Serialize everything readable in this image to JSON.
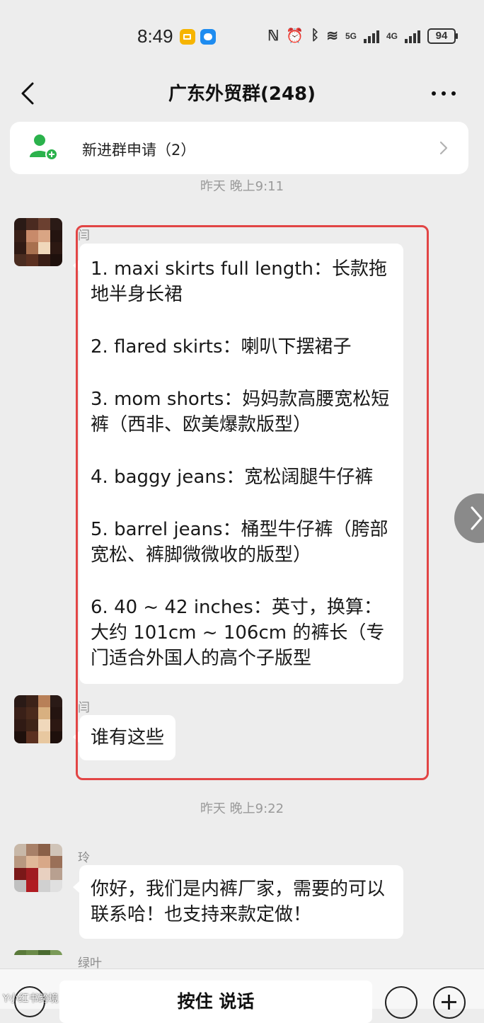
{
  "status_bar": {
    "time": "8:49",
    "network_5g": "5G",
    "network_4g": "4G",
    "battery": "94"
  },
  "header": {
    "title": "广东外贸群(248)"
  },
  "join_requests": {
    "label": "新进群申请（2）"
  },
  "timestamps": {
    "first": "昨天 晚上9:11",
    "second": "昨天 晚上9:22"
  },
  "messages": [
    {
      "sender": "闫",
      "lines": [
        "1. maxi skirts full length：长款拖地半身长裙",
        "2. flared skirts：喇叭下摆裙子",
        "3. mom shorts：妈妈款高腰宽松短裤（西非、欧美爆款版型）",
        "4. baggy jeans：宽松阔腿牛仔裤",
        "5. barrel jeans：桶型牛仔裤（胯部宽松、裤脚微微收的版型）",
        "6. 40 ~ 42 inches：英寸，换算：大约 101cm ~ 106cm 的裤长（专门适合外国人的高个子版型"
      ]
    },
    {
      "sender": "闫",
      "text": "谁有这些"
    },
    {
      "sender": "玲",
      "text": "你好，我们是内裤厂家，需要的可以联系哈！也支持来款定做！"
    },
    {
      "sender": "绿叶"
    }
  ],
  "input_bar": {
    "hold_to_talk": "按住 说话"
  },
  "watermark": "Y小红书跨境",
  "colors": {
    "background": "#ededed",
    "highlight_border": "#e24545",
    "join_icon": "#2bb24c"
  },
  "icons": [
    "back-arrow-icon",
    "more-icon",
    "add-user-icon",
    "chevron-right-icon",
    "voice-icon",
    "emoji-icon",
    "plus-icon"
  ]
}
